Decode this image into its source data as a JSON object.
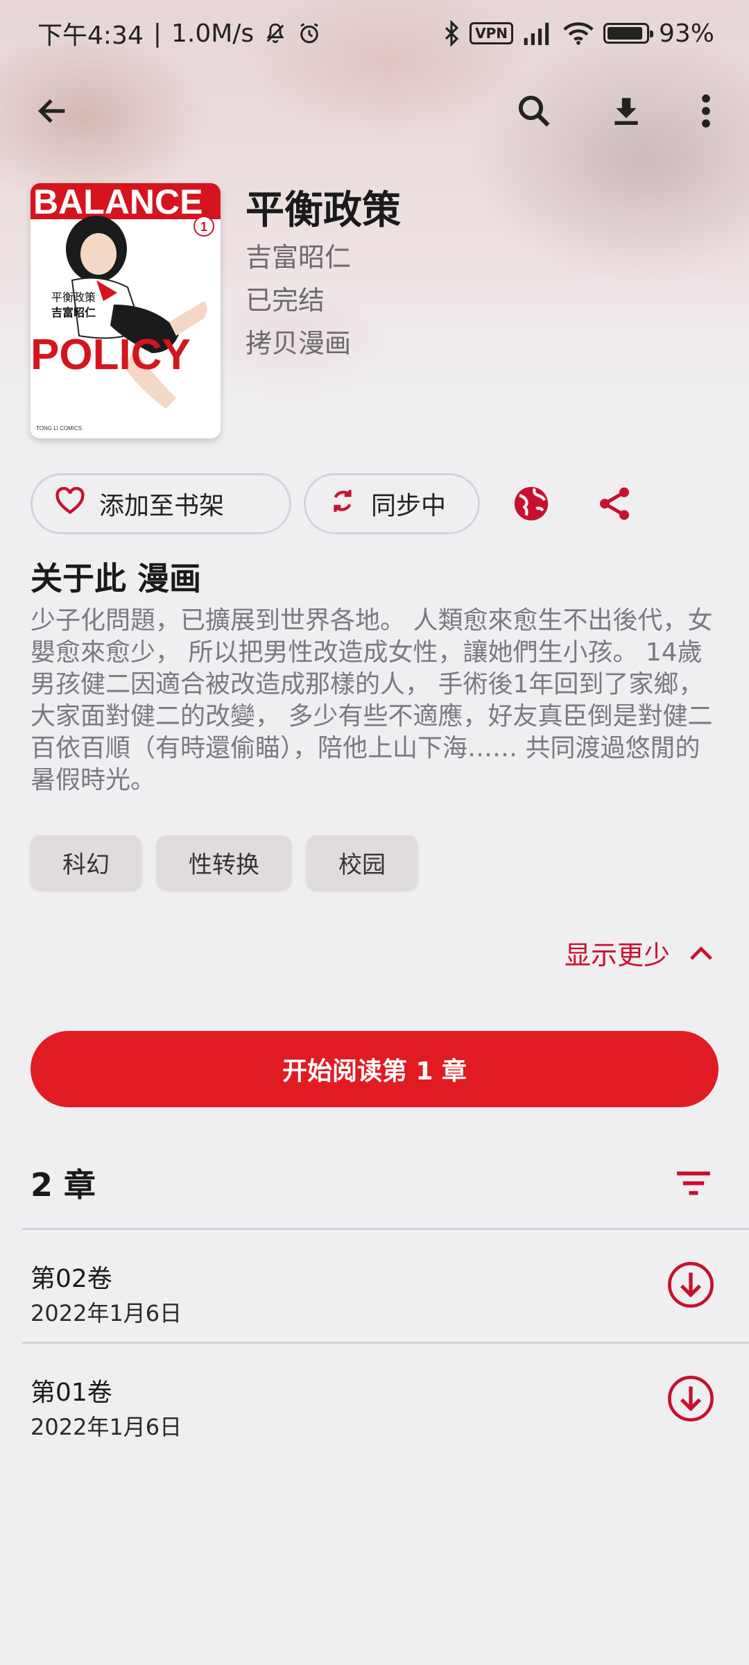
{
  "status_bar": {
    "time": "下午4:34",
    "speed": "1.0M/s",
    "vpn": "VPN",
    "battery_level": 93,
    "battery_text": "93%"
  },
  "app_bar": {
    "icons": [
      "back-arrow-icon",
      "search-icon",
      "download-icon",
      "more-vert-icon"
    ]
  },
  "manga": {
    "title": "平衡政策",
    "author": "吉富昭仁",
    "status": "已完结",
    "source": "拷贝漫画",
    "cover": {
      "top_text": "BALANCE",
      "bottom_text": "POLICY",
      "volume": "1",
      "cn_title": "平衡政策",
      "cn_author": "吉富昭仁",
      "publisher": "TONG LI COMICS"
    }
  },
  "actions": {
    "add_library": "添加至书架",
    "sync": "同步中"
  },
  "about": {
    "heading": "关于此 漫画",
    "description": "少子化問題，已擴展到世界各地。 人類愈來愈生不出後代，女嬰愈來愈少， 所以把男性改造成女性，讓她們生小孩。 14歲男孩健二因適合被改造成那樣的人， 手術後1年回到了家鄉，大家面對健二的改變， 多少有些不適應，好友真臣倒是對健二百依百順（有時還偷瞄），陪他上山下海…… 共同渡過悠閒的暑假時光。",
    "tags": [
      "科幻",
      "性转换",
      "校园"
    ],
    "show_less": "显示更少"
  },
  "start_button": "开始阅读第 1 章",
  "chapters": {
    "count_label": "2 章",
    "items": [
      {
        "name": "第02卷",
        "date": "2022年1月6日"
      },
      {
        "name": "第01卷",
        "date": "2022年1月6日"
      }
    ]
  },
  "colors": {
    "accent": "#e11b22",
    "background": "#efeef1"
  }
}
